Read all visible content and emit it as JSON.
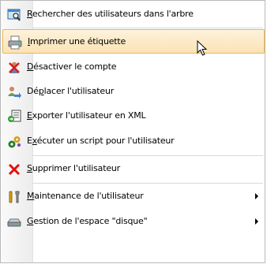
{
  "menu": {
    "items": [
      {
        "pre": "",
        "key": "R",
        "post": "echercher des utilisateurs dans l'arbre",
        "icon": "magnifier-search-icon"
      },
      {
        "pre": "",
        "key": "I",
        "post": "mprimer une étiquette",
        "icon": "printer-icon"
      },
      {
        "pre": "",
        "key": "D",
        "post": "ésactiver le compte",
        "icon": "user-disable-x-icon"
      },
      {
        "pre": "Dé",
        "key": "p",
        "post": "lacer l'utilisateur",
        "icon": "user-move-icon"
      },
      {
        "pre": "",
        "key": "E",
        "post": "xporter l'utilisateur en XML",
        "icon": "export-xml-icon"
      },
      {
        "pre": "E",
        "key": "x",
        "post": "écuter un script pour l'utilisateur",
        "icon": "script-gears-icon"
      },
      {
        "pre": "",
        "key": "S",
        "post": "upprimer l'utilisateur",
        "icon": "delete-x-icon"
      },
      {
        "pre": "",
        "key": "M",
        "post": "aintenance de l'utilisateur",
        "icon": "tools-maintenance-icon"
      },
      {
        "pre": "",
        "key": "G",
        "post": "estion de l'espace \"disque\"",
        "icon": "disk-drive-icon"
      }
    ],
    "highlight_color": "#fbe3b3"
  }
}
